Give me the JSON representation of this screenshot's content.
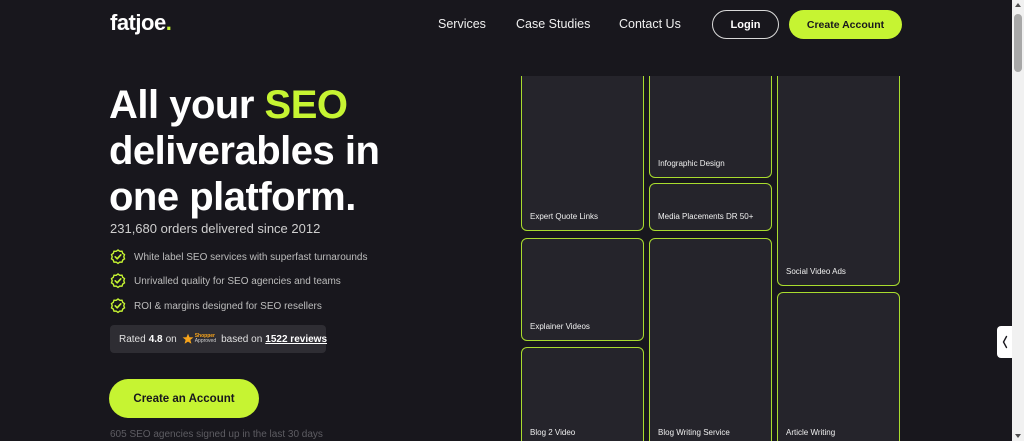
{
  "nav": {
    "logo_main": "fatjoe",
    "logo_dot": ".",
    "links": [
      "Services",
      "Case Studies",
      "Contact Us"
    ],
    "login_label": "Login",
    "create_label": "Create Account"
  },
  "hero": {
    "title_part1": "All your ",
    "title_highlight": "SEO",
    "title_line2": "deliverables in",
    "title_line3": "one platform.",
    "orders_text": "231,680 orders delivered since 2012",
    "features": [
      "White label SEO services with superfast turnarounds",
      "Unrivalled quality for SEO agencies and teams",
      "ROI & margins designed for SEO resellers"
    ],
    "rating": {
      "prefix": "Rated",
      "score": "4.8",
      "on": "on",
      "badge_line1": "Shopper",
      "badge_line2": "Approved",
      "based_on": "based on",
      "reviews": "1522 reviews"
    },
    "cta_label": "Create an Account",
    "signed_text": "605 SEO agencies signed up in the last 30 days"
  },
  "cards": [
    "Expert Quote Links",
    "Explainer Videos",
    "Blog 2 Video",
    "Infographic Design",
    "Media Placements DR 50+",
    "Blog Writing Service",
    "Social Video Ads",
    "Article Writing"
  ],
  "colors": {
    "background": "#18171d",
    "accent": "#c6f432",
    "card_bg": "#25242b",
    "card_border": "#a9dc2e"
  },
  "icons": {
    "feature": "check-circle-icon",
    "badge": "star-icon",
    "side_widget": "chevron-icon"
  }
}
